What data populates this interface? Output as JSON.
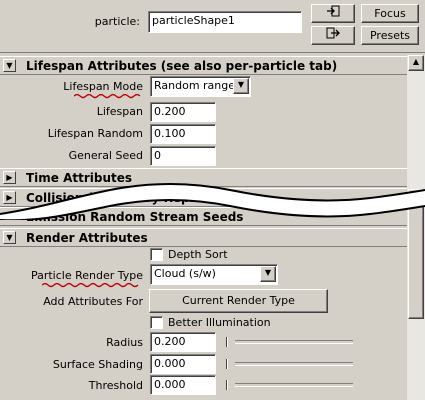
{
  "header": {
    "particle_label": "particle:",
    "particle_value": "particleShape1",
    "focus_label": "Focus",
    "presets_label": "Presets"
  },
  "lifespan": {
    "title": "Lifespan Attributes (see also per-particle tab)",
    "mode_label": "Lifespan Mode",
    "mode_value": "Random range",
    "lifespan_label": "Lifespan",
    "lifespan_value": "0.200",
    "random_label": "Lifespan Random",
    "random_value": "0.100",
    "seed_label": "General Seed",
    "seed_value": "0"
  },
  "sections": {
    "time": "Time Attributes",
    "collision": "Collision (Geometry Repla",
    "emission": "Emission Random Stream Seeds"
  },
  "render": {
    "title": "Render Attributes",
    "depth_sort_label": "Depth Sort",
    "render_type_label": "Particle Render Type",
    "render_type_value": "Cloud (s/w)",
    "add_attr_label": "Add Attributes For",
    "current_render_type_label": "Current Render Type",
    "better_illum_label": "Better Illumination",
    "radius_label": "Radius",
    "radius_value": "0.200",
    "surface_label": "Surface Shading",
    "surface_value": "0.000",
    "threshold_label": "Threshold",
    "threshold_value": "0.000"
  }
}
